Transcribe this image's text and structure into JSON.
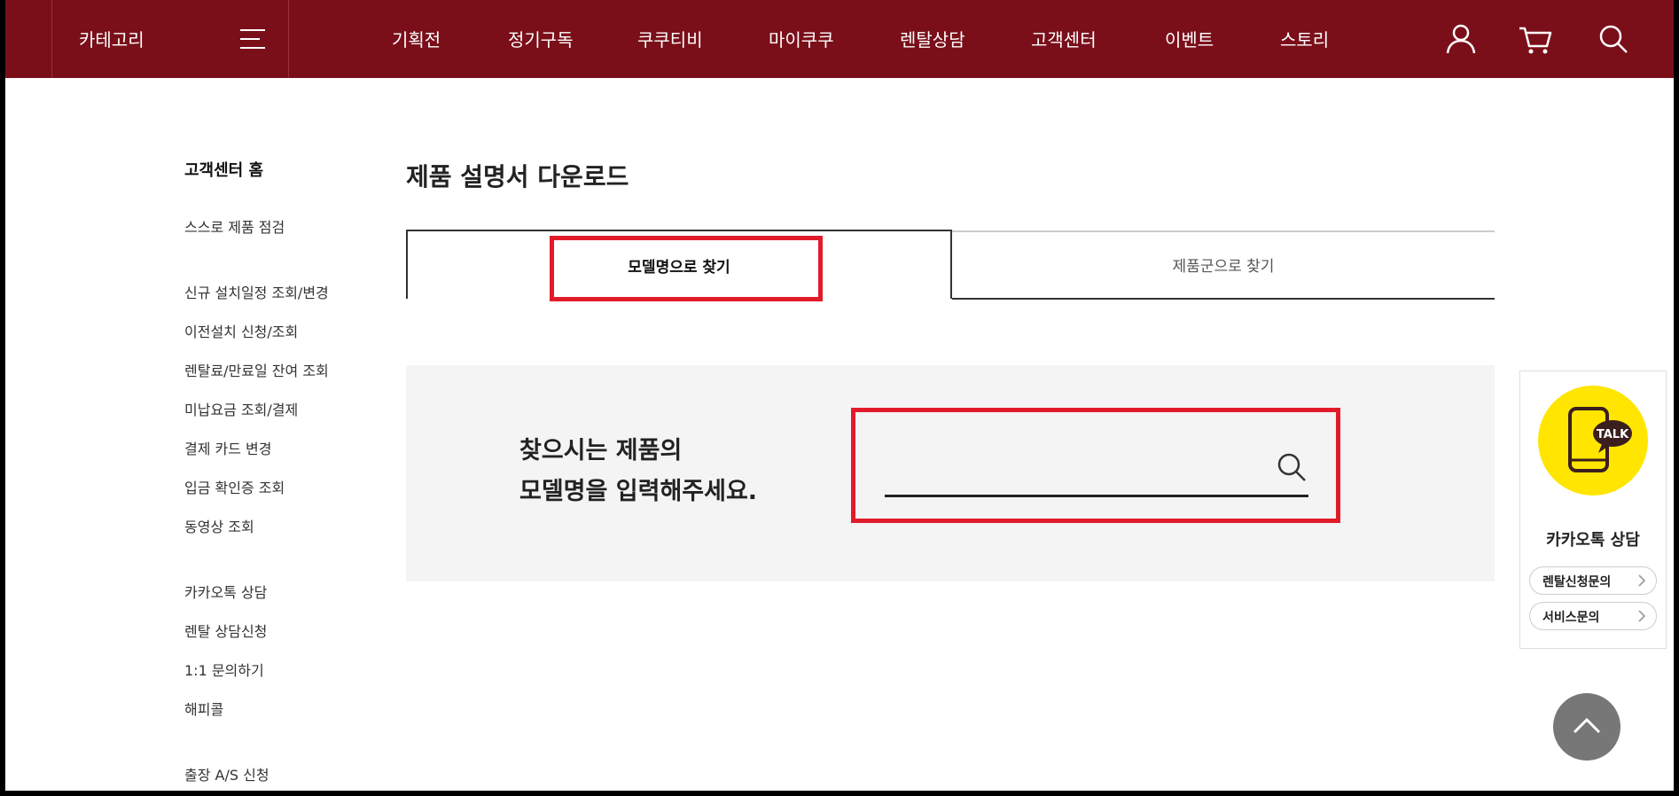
{
  "header": {
    "category_label": "카테고리",
    "nav": [
      "기획전",
      "정기구독",
      "쿠쿠티비",
      "마이쿠쿠",
      "렌탈상담",
      "고객센터",
      "이벤트",
      "스토리"
    ],
    "brand_color": "#7a0f1a"
  },
  "sidebar": {
    "home": "고객센터 홈",
    "self_check": "스스로 제품 점검",
    "group1": [
      "신규 설치일정 조회/변경",
      "이전설치 신청/조회",
      "렌탈료/만료일 잔여 조회",
      "미납요금 조회/결제",
      "결제 카드 변경",
      "입금 확인증 조회",
      "동영상 조회"
    ],
    "group2": [
      "카카오톡 상담",
      "렌탈 상담신청",
      "1:1 문의하기",
      "해피콜"
    ],
    "group3": [
      "출장 A/S 신청"
    ]
  },
  "main": {
    "title": "제품 설명서 다운로드",
    "tabs": [
      "모델명으로 찾기",
      "제품군으로 찾기"
    ],
    "search_guide_line1": "찾으시는 제품의",
    "search_guide_line2": "모델명을 입력해주세요.",
    "search_value": "",
    "highlight_color": "#e21b2a"
  },
  "talk_widget": {
    "badge": "TALK",
    "title": "카카오톡 상담",
    "buttons": [
      "렌탈신청문의",
      "서비스문의"
    ],
    "badge_color": "#ffe500"
  }
}
